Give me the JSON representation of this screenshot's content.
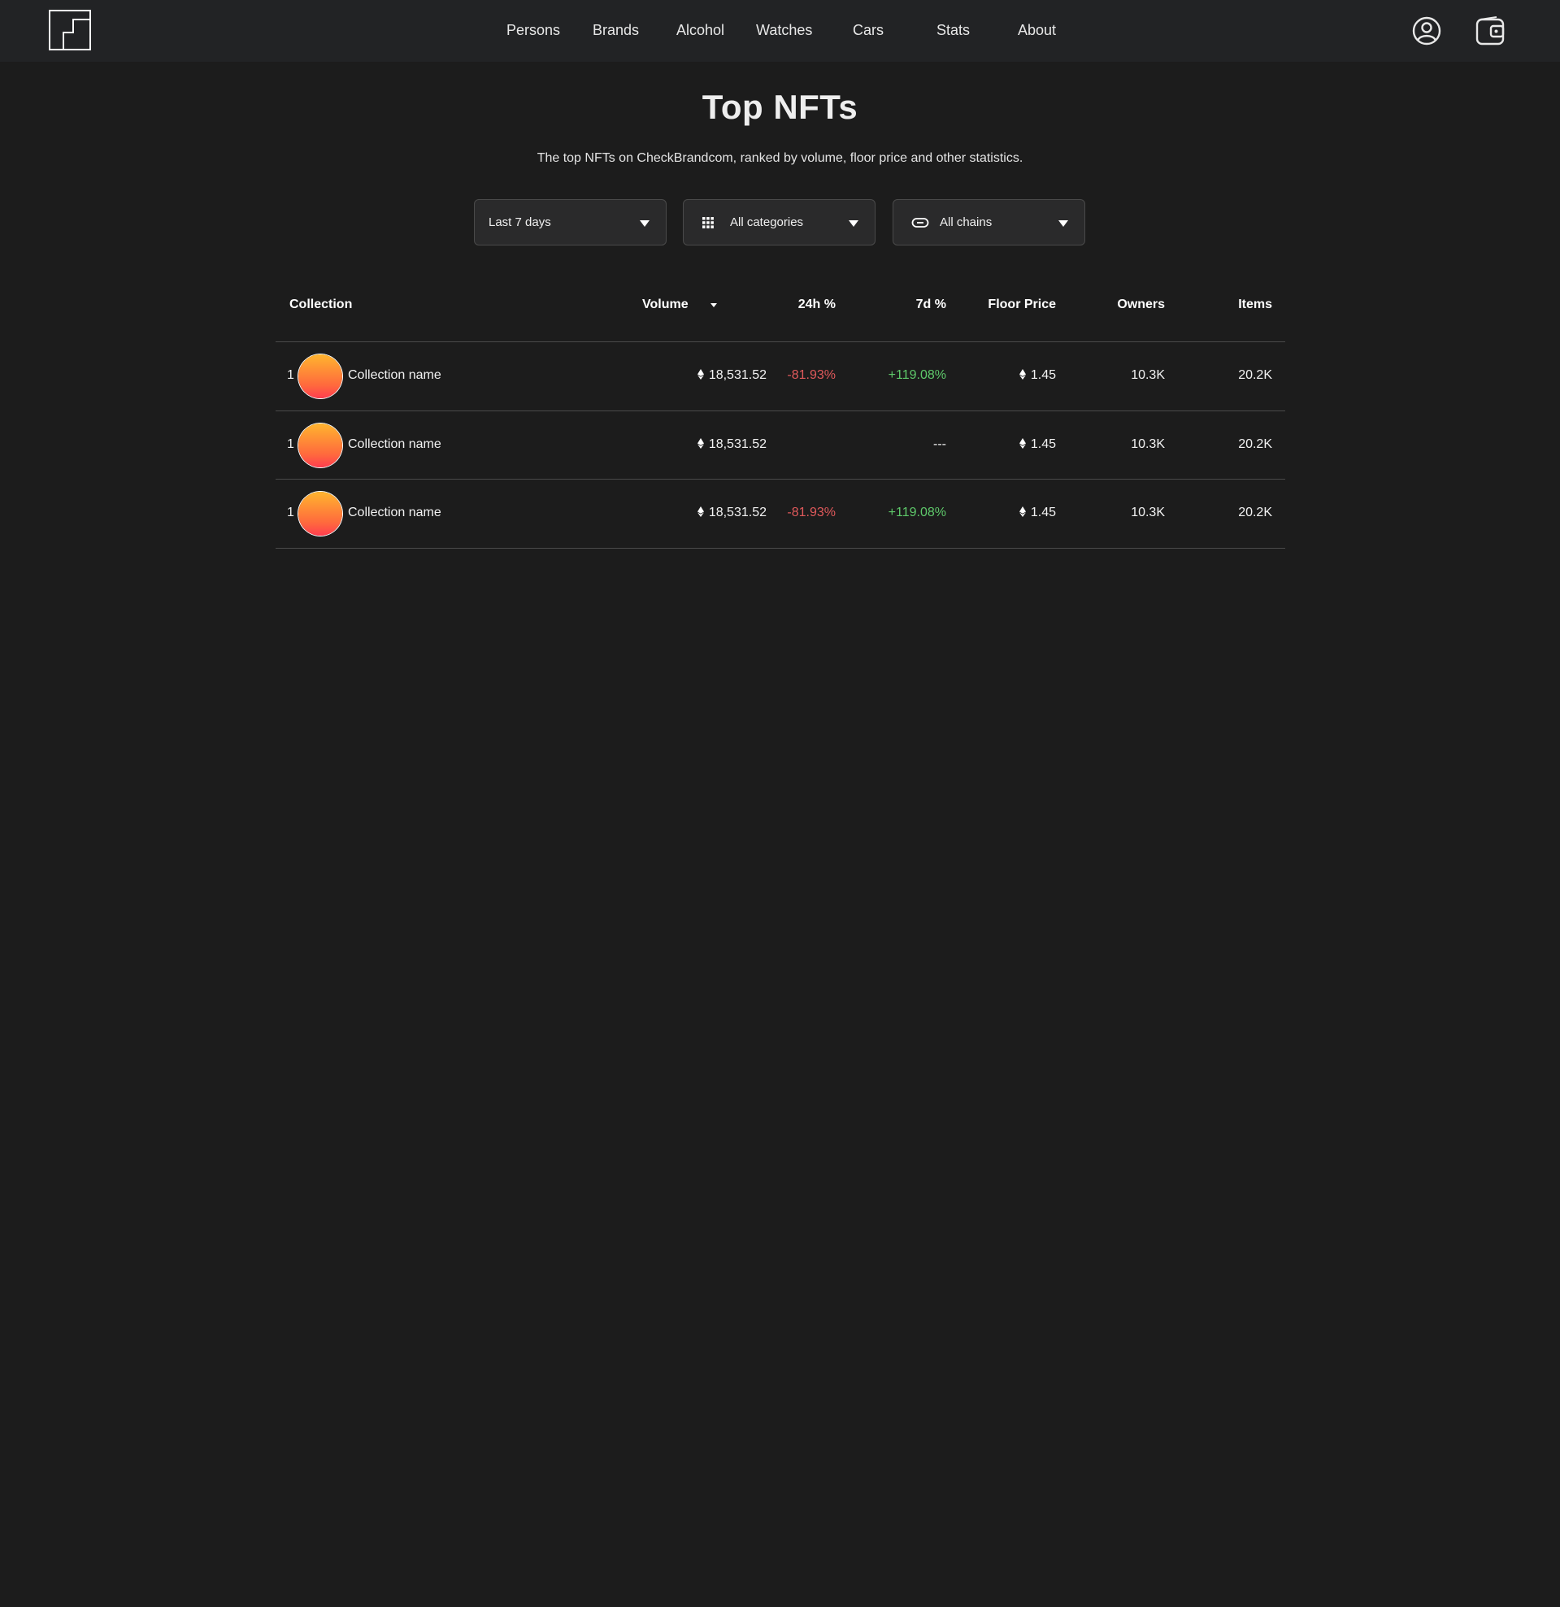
{
  "nav": {
    "items": [
      "Persons",
      "Brands",
      "Alcohol",
      "Watches",
      "Cars",
      "Stats",
      "About"
    ]
  },
  "header_icons": [
    "user-circle-icon",
    "wallet-icon"
  ],
  "page": {
    "title": "Top NFTs",
    "subtitle": "The top NFTs on CheckBrandcom, ranked by volume, floor price and other statistics."
  },
  "filters": {
    "period": "Last 7 days",
    "category": "All categories",
    "chain": "All chains"
  },
  "table": {
    "columns": {
      "collection": "Collection",
      "volume": "Volume",
      "change_24h": "24h %",
      "change_7d": "7d %",
      "floor_price": "Floor Price",
      "owners": "Owners",
      "items": "Items"
    },
    "rows": [
      {
        "rank": "1",
        "name": "Collection name",
        "volume": "18,531.52",
        "change_24h": "-81.93%",
        "change_7d": "+119.08%",
        "floor_price": "1.45",
        "owners": "10.3K",
        "items": "20.2K"
      },
      {
        "rank": "1",
        "name": "Collection name",
        "volume": "18,531.52",
        "change_24h": "",
        "change_7d": "---",
        "floor_price": "1.45",
        "owners": "10.3K",
        "items": "20.2K"
      },
      {
        "rank": "1",
        "name": "Collection name",
        "volume": "18,531.52",
        "change_24h": "-81.93%",
        "change_7d": "+119.08%",
        "floor_price": "1.45",
        "owners": "10.3K",
        "items": "20.2K"
      }
    ]
  },
  "colors": {
    "background": "#1c1c1c",
    "header": "#222325",
    "negative": "#e0595b",
    "positive": "#5ec86a"
  }
}
